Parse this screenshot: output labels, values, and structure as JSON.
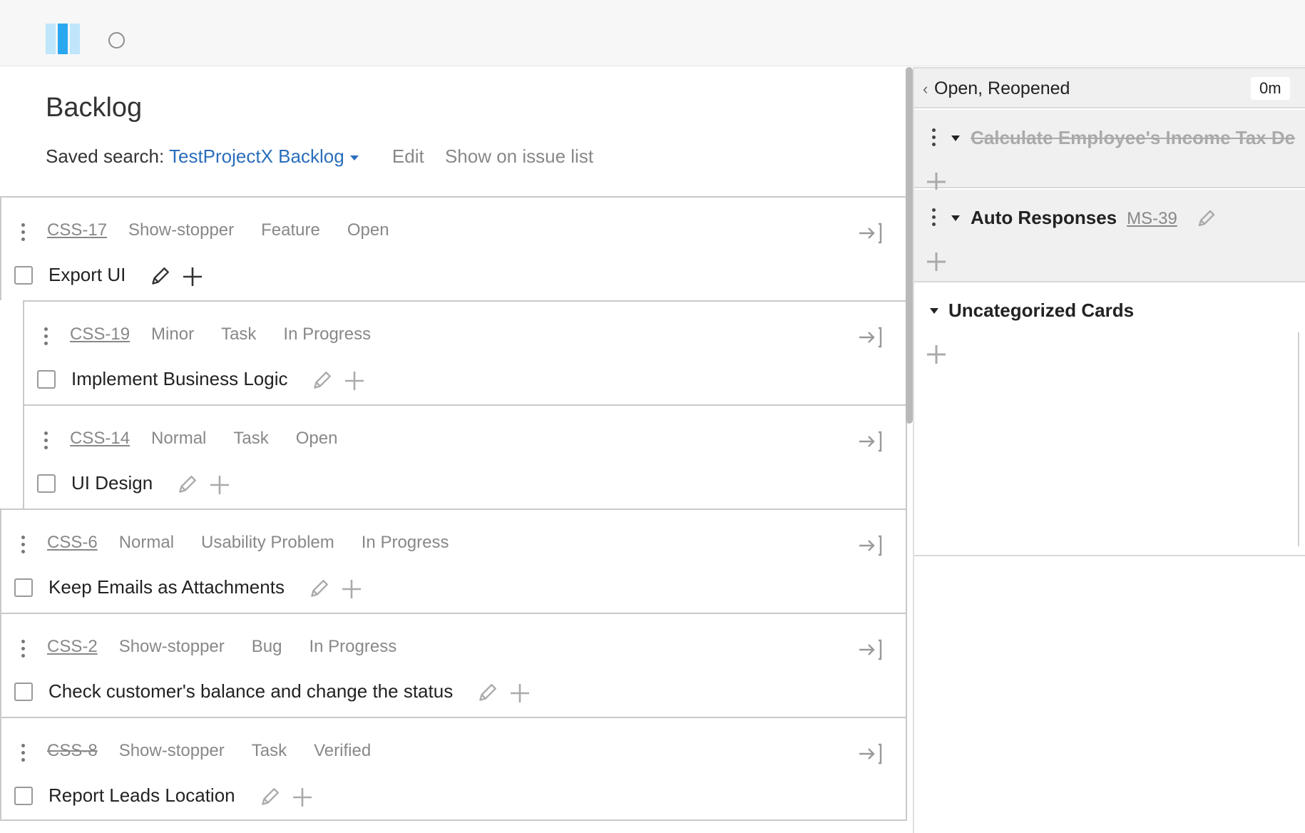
{
  "page": {
    "title": "Backlog",
    "saved_search_label": "Saved search:",
    "saved_search_value": "TestProjectX Backlog",
    "edit_label": "Edit",
    "show_on_list_label": "Show on issue list"
  },
  "issues": [
    {
      "id": "CSS-17",
      "priority": "Show-stopper",
      "type": "Feature",
      "state": "Open",
      "summary": "Export UI",
      "child": false,
      "resolved": false
    },
    {
      "id": "CSS-19",
      "priority": "Minor",
      "type": "Task",
      "state": "In Progress",
      "summary": "Implement Business Logic",
      "child": true,
      "resolved": false
    },
    {
      "id": "CSS-14",
      "priority": "Normal",
      "type": "Task",
      "state": "Open",
      "summary": "UI Design",
      "child": true,
      "resolved": false
    },
    {
      "id": "CSS-6",
      "priority": "Normal",
      "type": "Usability Problem",
      "state": "In Progress",
      "summary": "Keep Emails as Attachments",
      "child": false,
      "resolved": false
    },
    {
      "id": "CSS-2",
      "priority": "Show-stopper",
      "type": "Bug",
      "state": "In Progress",
      "summary": "Check customer's balance and change the status",
      "child": false,
      "resolved": false
    },
    {
      "id": "CSS-8",
      "priority": "Show-stopper",
      "type": "Task",
      "state": "Verified",
      "summary": "Report Leads Location",
      "child": false,
      "resolved": true
    }
  ],
  "board": {
    "column_title": "Open, Reopened",
    "column_badge": "0m",
    "swimlanes": [
      {
        "name": "Calculate Employee's Income Tax De",
        "ref": "",
        "strike": true
      },
      {
        "name": "Auto Responses",
        "ref": "MS-39",
        "strike": false
      }
    ],
    "uncategorized_label": "Uncategorized Cards"
  }
}
